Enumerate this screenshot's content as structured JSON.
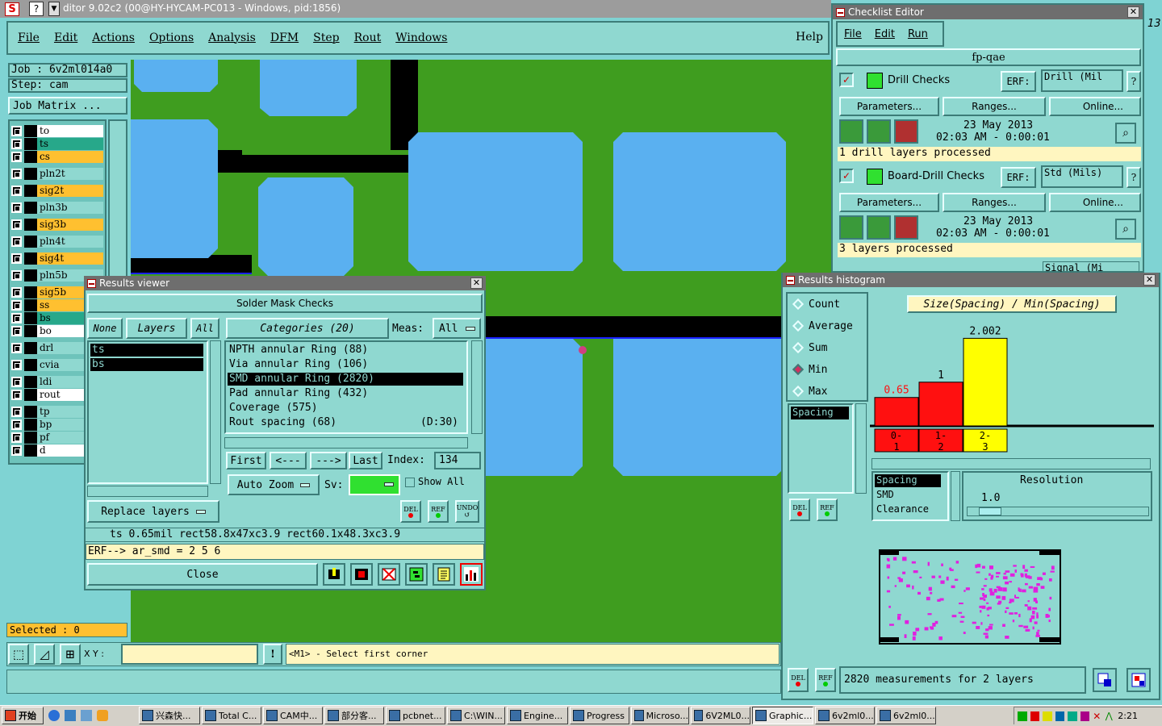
{
  "titlebar": {
    "title": "ditor 9.02c2 (00@HY-HYCAM-PC013 - Windows, pid:1856)"
  },
  "menu": [
    "File",
    "Edit",
    "Actions",
    "Options",
    "Analysis",
    "DFM",
    "Step",
    "Rout",
    "Windows"
  ],
  "help": "Help",
  "job": {
    "job": "Job  : 6v2ml014a0",
    "step": "Step: cam",
    "matrix": "Job Matrix ..."
  },
  "layers": [
    {
      "name": "to",
      "bg": "#ffffff"
    },
    {
      "name": "ts",
      "bg": "#27a88a"
    },
    {
      "name": "cs",
      "bg": "#ffc030"
    },
    {
      "name": "pln2t",
      "bg": "#8fd8d0"
    },
    {
      "name": "sig2t",
      "bg": "#ffc030"
    },
    {
      "name": "pln3b",
      "bg": "#8fd8d0"
    },
    {
      "name": "sig3b",
      "bg": "#ffc030"
    },
    {
      "name": "pln4t",
      "bg": "#8fd8d0"
    },
    {
      "name": "sig4t",
      "bg": "#ffc030"
    },
    {
      "name": "pln5b",
      "bg": "#8fd8d0"
    },
    {
      "name": "sig5b",
      "bg": "#ffc030"
    },
    {
      "name": "ss",
      "bg": "#ffc030"
    },
    {
      "name": "bs",
      "bg": "#27a88a"
    },
    {
      "name": "bo",
      "bg": "#ffffff"
    },
    {
      "name": "drl",
      "bg": "#8fd8d0"
    },
    {
      "name": "cvia",
      "bg": "#8fd8d0"
    },
    {
      "name": "ldi",
      "bg": "#8fd8d0"
    },
    {
      "name": "rout",
      "bg": "#ffffff"
    },
    {
      "name": "tp",
      "bg": "#8fd8d0"
    },
    {
      "name": "bp",
      "bg": "#8fd8d0"
    },
    {
      "name": "pf",
      "bg": "#8fd8d0"
    },
    {
      "name": "d",
      "bg": "#ffffff"
    }
  ],
  "selected": "Selected : 0",
  "bottom": {
    "xy_label": "X Y :",
    "bang": "!",
    "prompt": "<M1> - Select first corner"
  },
  "results_viewer": {
    "title": "Results viewer",
    "header": "Solder Mask Checks",
    "none": "None",
    "layers": "Layers",
    "all": "All",
    "categories": "Categories (20)",
    "meas": "Meas:",
    "meas_value": "All",
    "layer_list": [
      "ts",
      "bs"
    ],
    "category_list": [
      {
        "label": "NPTH annular Ring (88)",
        "extra": ""
      },
      {
        "label": "Via annular Ring (106)",
        "extra": ""
      },
      {
        "label": "SMD annular Ring (2820)",
        "extra": ""
      },
      {
        "label": "Pad annular Ring (432)",
        "extra": ""
      },
      {
        "label": "Coverage (575)",
        "extra": ""
      },
      {
        "label": "Rout spacing (68)",
        "extra": "(D:30)"
      }
    ],
    "nav": {
      "first": "First",
      "prev": "<---",
      "next": "--->",
      "last": "Last",
      "index_label": "Index:",
      "index_value": "134"
    },
    "auto_zoom": "Auto Zoom",
    "sv": "Sv:",
    "show_all": "Show All",
    "replace": "Replace layers",
    "del": "DEL",
    "ref": "REF",
    "undo": "UNDO",
    "info": "ts 0.65mil   rect58.8x47xc3.9   rect60.1x48.3xc3.9",
    "erf": "ERF--> ar_smd = 2 5 6",
    "close": "Close"
  },
  "checklist": {
    "title": "Checklist Editor",
    "menu": [
      "File",
      "Edit",
      "Run"
    ],
    "name": "fp-qae",
    "checks": [
      {
        "name": "Drill Checks",
        "erf": "ERF:",
        "erf_value": "Drill (Mil",
        "params": "Parameters...",
        "ranges": "Ranges...",
        "online": "Online...",
        "date": "23 May 2013",
        "time": "02:03 AM - 0:00:01",
        "status": "1 drill layers processed"
      },
      {
        "name": "Board-Drill Checks",
        "erf": "ERF:",
        "erf_value": "Std (Mils)",
        "params": "Parameters...",
        "ranges": "Ranges...",
        "online": "Online...",
        "date": "23 May 2013",
        "time": "02:03 AM - 0:00:01",
        "status": "3 layers processed"
      }
    ],
    "partial": "Signal (Mi"
  },
  "histogram": {
    "title": "Results histogram",
    "options": [
      {
        "label": "Count",
        "selected": false
      },
      {
        "label": "Average",
        "selected": false
      },
      {
        "label": "Sum",
        "selected": false
      },
      {
        "label": "Min",
        "selected": true
      },
      {
        "label": "Max",
        "selected": false
      }
    ],
    "list": [
      "Spacing"
    ],
    "chart_title": "Size(Spacing) / Min(Spacing)",
    "list2": [
      "Spacing",
      "SMD",
      "Clearance"
    ],
    "resolution_label": "Resolution",
    "resolution_value": "1.0",
    "summary": "2820 measurements for 2 layers",
    "del": "DEL",
    "ref": "REF"
  },
  "chart_data": {
    "type": "bar",
    "title": "Size(Spacing) / Min(Spacing)",
    "categories": [
      "0-1",
      "1-2",
      "2-3"
    ],
    "values": [
      0.65,
      1,
      2.002
    ],
    "labels": [
      "0.65",
      "1",
      "2.002"
    ],
    "colors": [
      "#ff1010",
      "#ff1010",
      "#ffff00"
    ],
    "label_colors": [
      "#ff1010",
      "#000000",
      "#000000"
    ],
    "ylim": [
      0,
      2.4
    ]
  },
  "taskbar": {
    "start": "开始",
    "items": [
      "兴森快...",
      "Total C...",
      "CAM中...",
      "部分客...",
      "pcbnet...",
      "C:\\WIN...",
      "Engine...",
      "Progress",
      "Microso...",
      "6V2ML0...",
      "Graphic...",
      "6v2ml0...",
      "6v2ml0..."
    ],
    "clock": "2:21"
  },
  "edge_text": "13"
}
